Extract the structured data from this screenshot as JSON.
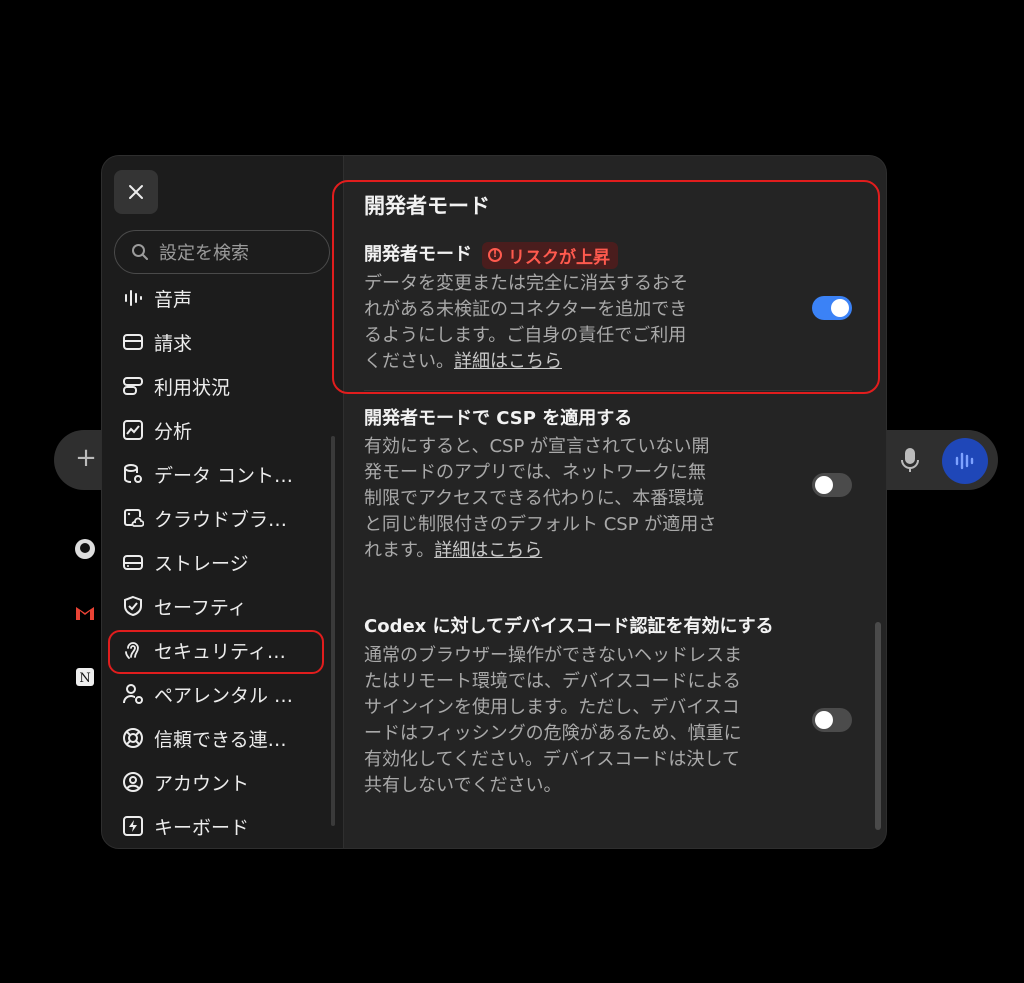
{
  "sidebar": {
    "search_placeholder": "設定を検索",
    "items": [
      {
        "label": "音声",
        "icon": "audio-wave-icon"
      },
      {
        "label": "請求",
        "icon": "credit-card-icon"
      },
      {
        "label": "利用状況",
        "icon": "usage-bars-icon"
      },
      {
        "label": "分析",
        "icon": "analytics-chart-icon"
      },
      {
        "label": "データ コント…",
        "icon": "database-gear-icon"
      },
      {
        "label": "クラウドブラ…",
        "icon": "cloud-browser-icon"
      },
      {
        "label": "ストレージ",
        "icon": "storage-drive-icon"
      },
      {
        "label": "セーフティ",
        "icon": "shield-check-icon"
      },
      {
        "label": "セキュリティ…",
        "icon": "security-lock-icon",
        "active": true
      },
      {
        "label": "ペアレンタル …",
        "icon": "parental-person-icon"
      },
      {
        "label": "信頼できる連…",
        "icon": "lifebuoy-icon"
      },
      {
        "label": "アカウント",
        "icon": "account-circle-icon"
      },
      {
        "label": "キーボード",
        "icon": "keyboard-bolt-icon"
      }
    ]
  },
  "main": {
    "section_title": "開発者モード",
    "dev_mode": {
      "title": "開発者モード",
      "badge": "リスクが上昇",
      "desc": "データを変更または完全に消去するおそれがある未検証のコネクターを追加できるようにします。ご自身の責任でご利用ください。",
      "link": "詳細はこちら",
      "enabled": true
    },
    "csp": {
      "title": "開発者モードで CSP を適用する",
      "desc": "有効にすると、CSP が宣言されていない開発モードのアプリでは、ネットワークに無制限でアクセスできる代わりに、本番環境と同じ制限付きのデフォルト CSP が適用されます。",
      "link": "詳細はこちら",
      "enabled": false
    },
    "codex": {
      "title": "Codex に対してデバイスコード認証を有効にする",
      "desc": "通常のブラウザー操作ができないヘッドレスまたはリモート環境では、デバイスコードによるサインインを使用します。ただし、デバイスコードはフィッシングの危険があるため、慎重に有効化してください。デバイスコードは決して共有しないでください。",
      "enabled": false
    }
  },
  "colors": {
    "accent": "#3b82f6",
    "danger": "#e11d1d",
    "badge_text": "#ff5a4e"
  }
}
